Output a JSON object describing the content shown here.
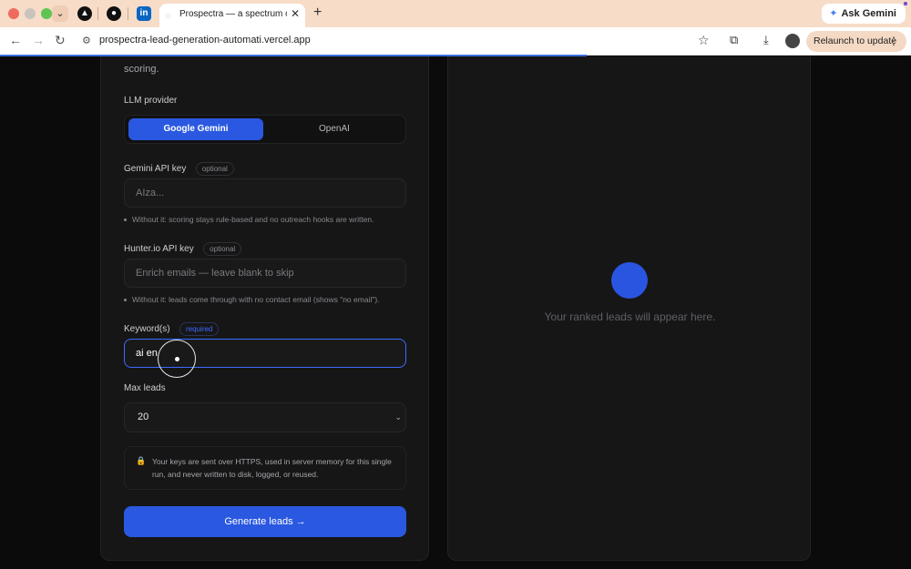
{
  "browser": {
    "tab_title": "Prospectra — a spectrum of lead",
    "pinned": {
      "a": "▲",
      "gh": "●",
      "in": "in"
    },
    "ask_gemini": "Ask Gemini",
    "url": "prospectra-lead-generation-automati.vercel.app",
    "relaunch": "Relaunch to update"
  },
  "form": {
    "intro_fragment": "scoring.",
    "llm_provider_label": "LLM provider",
    "providers": [
      "Google Gemini",
      "OpenAI"
    ],
    "selected_provider": "Google Gemini",
    "gemini": {
      "label": "Gemini API key",
      "badge": "optional",
      "placeholder": "AIza...",
      "hint": "Without it: scoring stays rule-based and no outreach hooks are written."
    },
    "hunter": {
      "label": "Hunter.io API key",
      "badge": "optional",
      "placeholder": "Enrich emails — leave blank to skip",
      "hint": "Without it: leads come through with no contact email (shows \"no email\")."
    },
    "keywords": {
      "label": "Keyword(s)",
      "badge": "required",
      "value": "ai en"
    },
    "max_leads": {
      "label": "Max leads",
      "value": "20"
    },
    "notice": "Your keys are sent over HTTPS, used in server memory for this single run, and never written to disk, logged, or reused.",
    "generate_label": "Generate leads →"
  },
  "results": {
    "empty_text": "Your ranked leads will appear here."
  },
  "colors": {
    "accent": "#2a58e0",
    "background": "#0b0b0c",
    "panel": "#161617"
  }
}
